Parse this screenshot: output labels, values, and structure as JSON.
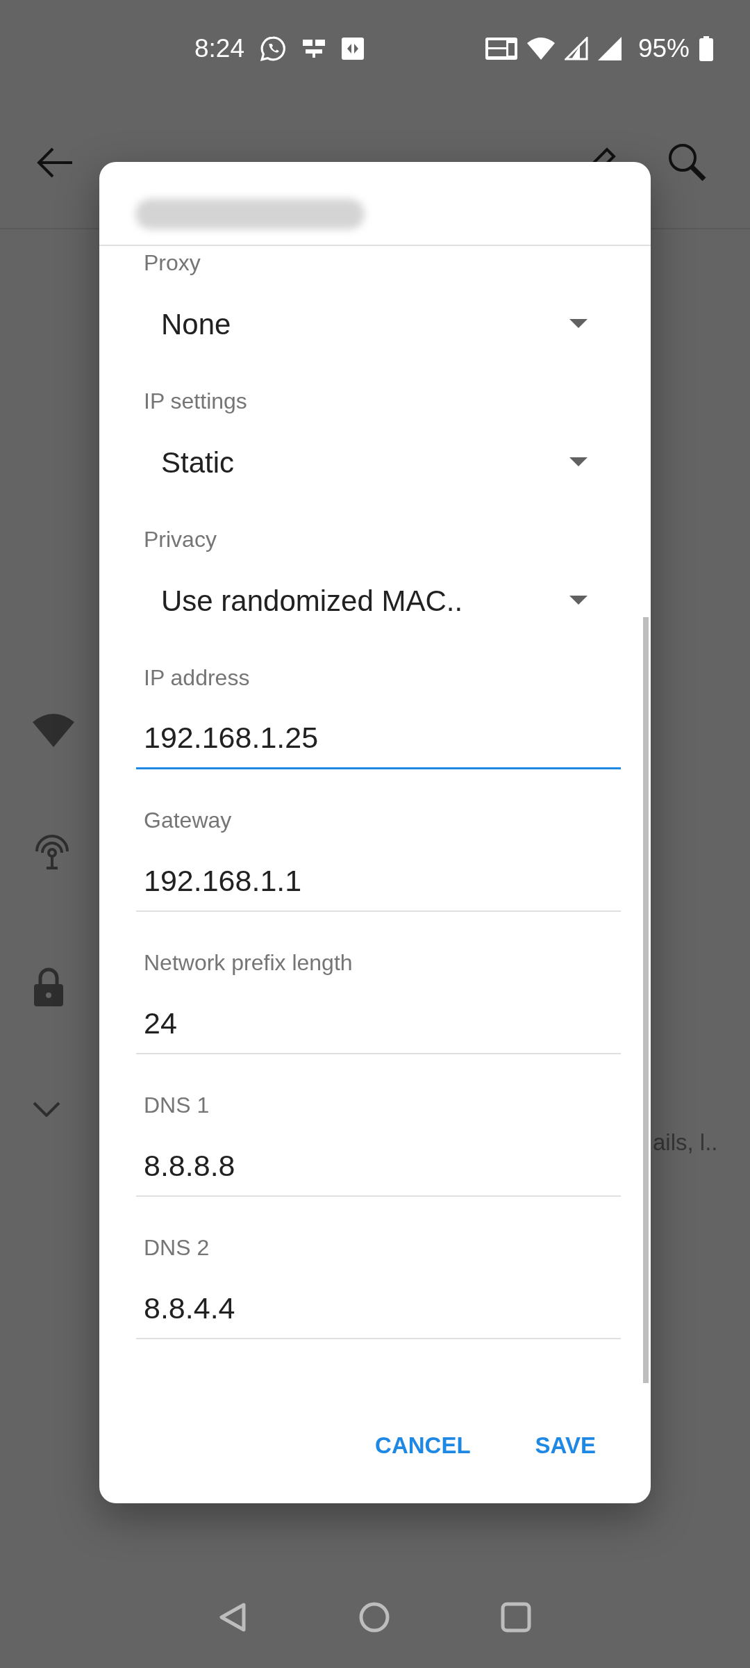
{
  "status_bar": {
    "time": "8:24",
    "battery": "95%"
  },
  "background": {
    "summary_fragment": "ails, l.."
  },
  "dialog": {
    "fields": [
      {
        "kind": "dropdown",
        "label": "Proxy",
        "value": "None",
        "focused": false
      },
      {
        "kind": "dropdown",
        "label": "IP settings",
        "value": "Static",
        "focused": false
      },
      {
        "kind": "dropdown",
        "label": "Privacy",
        "value": "Use randomized MAC..",
        "focused": false
      },
      {
        "kind": "text",
        "label": "IP address",
        "value": "192.168.1.25",
        "focused": true
      },
      {
        "kind": "text",
        "label": "Gateway",
        "value": "192.168.1.1",
        "focused": false
      },
      {
        "kind": "text",
        "label": "Network prefix length",
        "value": "24",
        "focused": false
      },
      {
        "kind": "text",
        "label": "DNS 1",
        "value": "8.8.8.8",
        "focused": false
      },
      {
        "kind": "text",
        "label": "DNS 2",
        "value": "8.8.4.4",
        "focused": false
      }
    ],
    "buttons": [
      {
        "label": "CANCEL"
      },
      {
        "label": "SAVE"
      }
    ]
  }
}
